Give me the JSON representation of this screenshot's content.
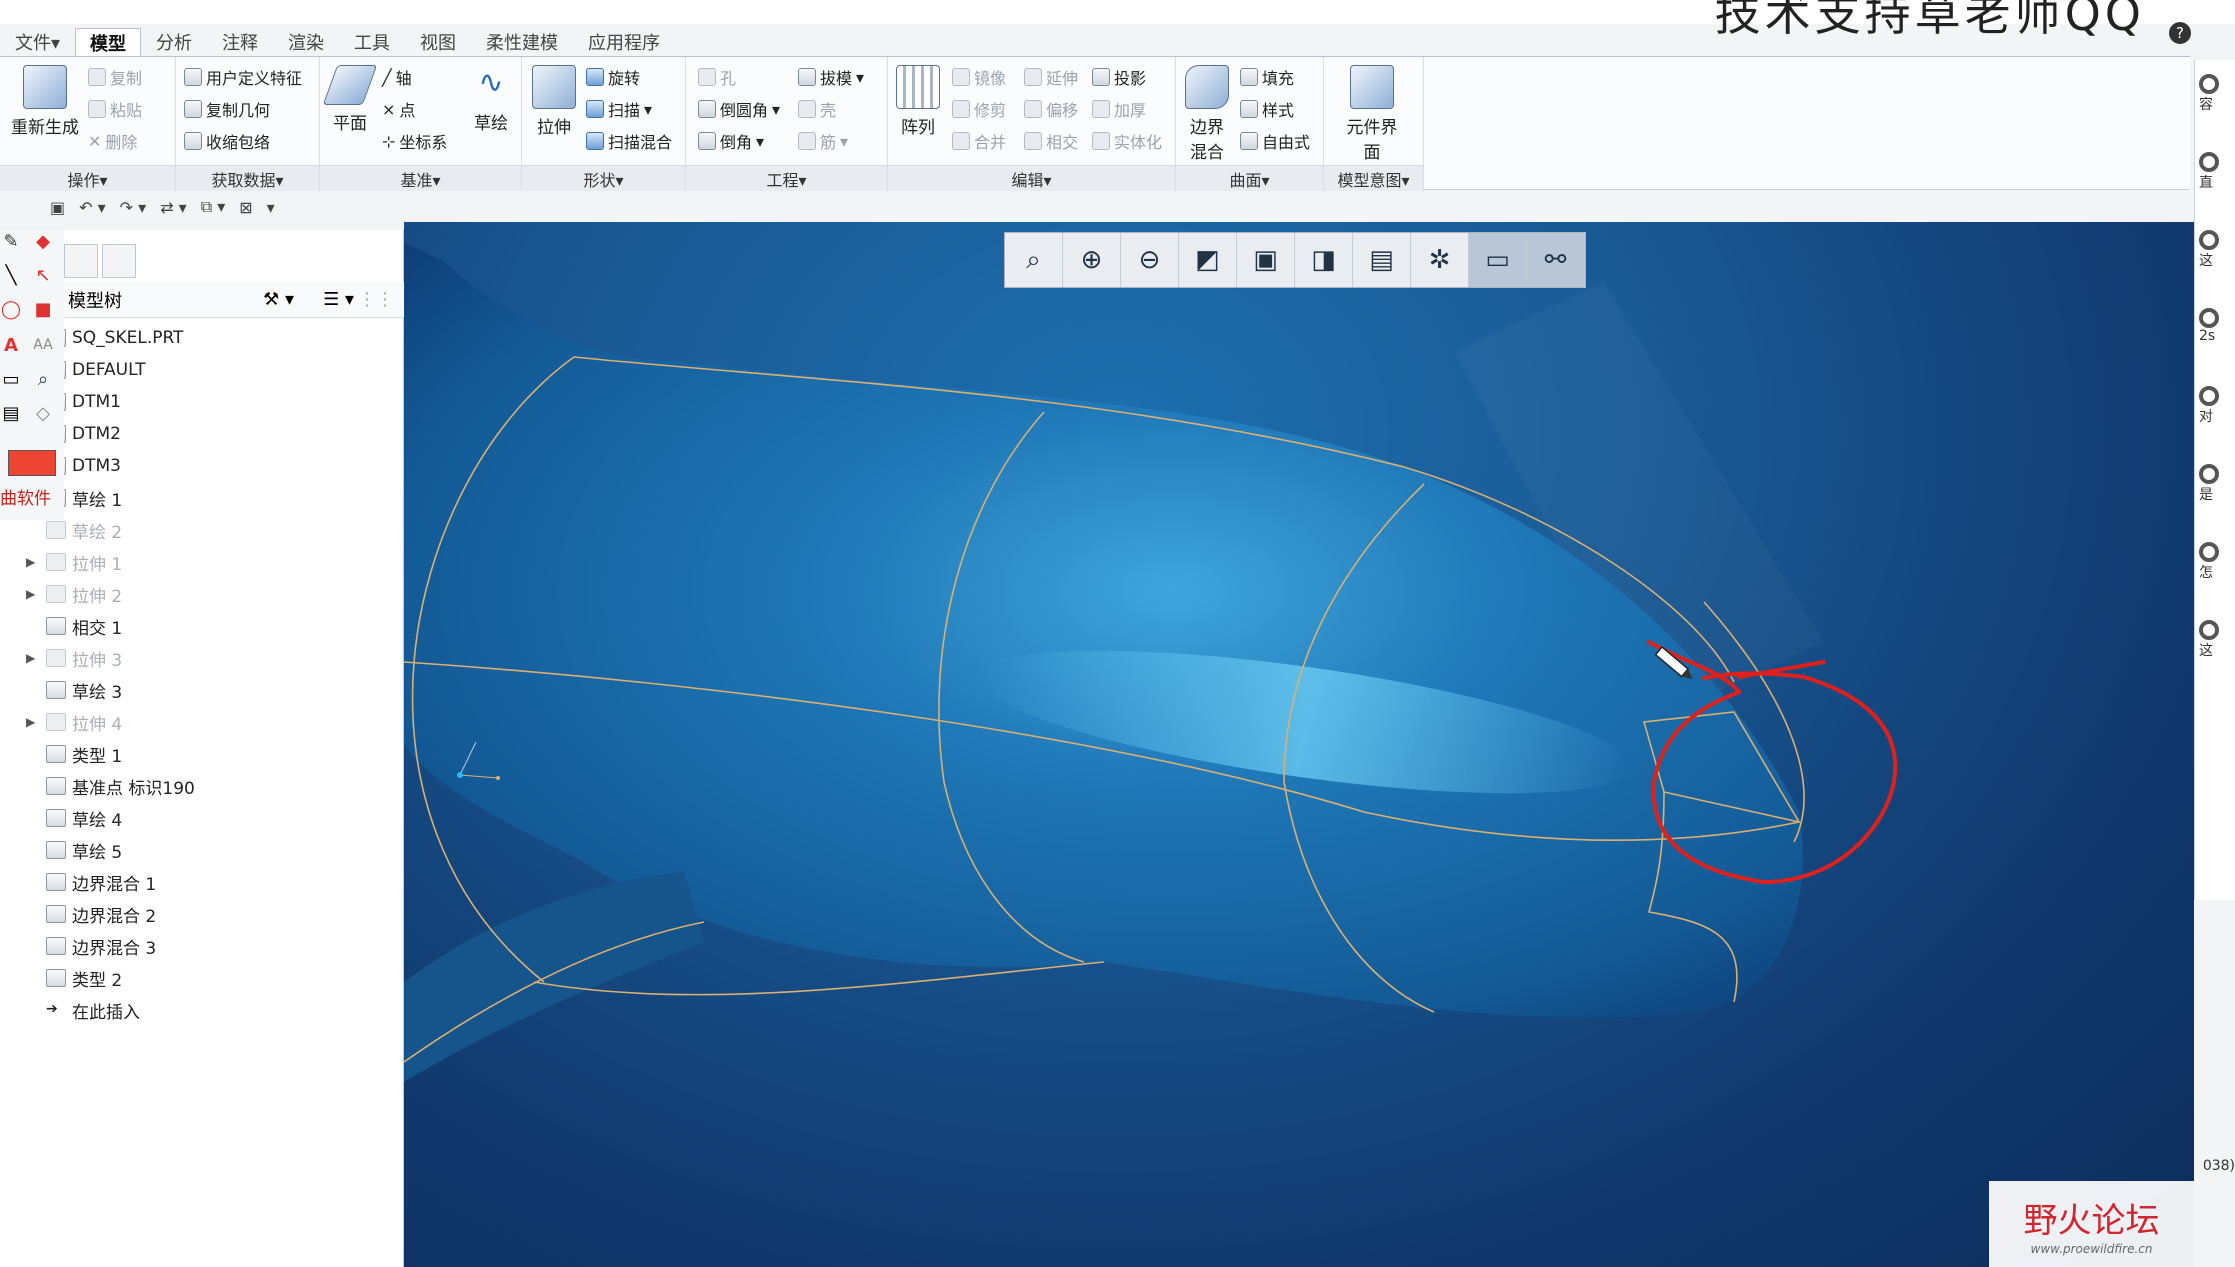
{
  "window": {
    "overlay_title": "技术支持草老师QQ"
  },
  "menu_tabs": [
    "文件▾",
    "模型",
    "分析",
    "注释",
    "渲染",
    "工具",
    "视图",
    "柔性建模",
    "应用程序"
  ],
  "ribbon": {
    "operations": {
      "label": "操作▾",
      "regenerate": "重新生成",
      "copy": "复制",
      "paste": "粘贴",
      "delete": "删除"
    },
    "get_data": {
      "label": "获取数据▾",
      "udf": "用户定义特征",
      "copy_geom": "复制几何",
      "shrinkwrap": "收缩包络"
    },
    "datum": {
      "label": "基准▾",
      "plane": "平面",
      "axis": "轴",
      "point": "点",
      "csys": "坐标系",
      "sketch": "草绘"
    },
    "shapes": {
      "label": "形状▾",
      "extrude": "拉伸",
      "revolve": "旋转",
      "sweep": "扫描",
      "swept_blend": "扫描混合"
    },
    "engineering": {
      "label": "工程▾",
      "hole": "孔",
      "round": "倒圆角",
      "chamfer": "倒角",
      "draft": "拔模",
      "shell": "壳",
      "rib": "筋"
    },
    "editing": {
      "label": "编辑▾",
      "pattern": "阵列",
      "mirror": "镜像",
      "extend": "延伸",
      "project": "投影",
      "trim": "修剪",
      "offset": "偏移",
      "thicken": "加厚",
      "merge": "合并",
      "intersect": "相交",
      "solidify": "实体化"
    },
    "surfaces": {
      "label": "曲面▾",
      "boundary_blend": "边界混合",
      "fill": "填充",
      "style": "样式",
      "freestyle": "自由式"
    },
    "model_intent": {
      "label": "模型意图▾",
      "component_interface": "元件界面"
    }
  },
  "left_panel": {
    "tree_header": "模型树",
    "red_label": "曲软件",
    "items": [
      {
        "label": "SQ_SKEL.PRT",
        "state": "normal"
      },
      {
        "label": "DEFAULT",
        "state": "normal"
      },
      {
        "label": "DTM1",
        "state": "normal"
      },
      {
        "label": "DTM2",
        "state": "normal"
      },
      {
        "label": "DTM3",
        "state": "normal"
      },
      {
        "label": "草绘 1",
        "state": "normal"
      },
      {
        "label": "草绘 2",
        "state": "disabled"
      },
      {
        "label": "拉伸 1",
        "state": "disabled",
        "expandable": true
      },
      {
        "label": "拉伸 2",
        "state": "disabled",
        "expandable": true
      },
      {
        "label": "相交 1",
        "state": "normal"
      },
      {
        "label": "拉伸 3",
        "state": "disabled",
        "expandable": true
      },
      {
        "label": "草绘 3",
        "state": "normal"
      },
      {
        "label": "拉伸 4",
        "state": "disabled",
        "expandable": true
      },
      {
        "label": "类型 1",
        "state": "normal"
      },
      {
        "label": "基准点 标识190",
        "state": "normal"
      },
      {
        "label": "草绘 4",
        "state": "normal"
      },
      {
        "label": "草绘 5",
        "state": "normal"
      },
      {
        "label": "边界混合 1",
        "state": "normal"
      },
      {
        "label": "边界混合 2",
        "state": "normal"
      },
      {
        "label": "边界混合 3",
        "state": "normal"
      },
      {
        "label": "类型 2",
        "state": "normal"
      },
      {
        "label": "在此插入",
        "state": "insert"
      }
    ]
  },
  "right_strip": [
    "容",
    "直",
    "这",
    "2s",
    "对",
    "是",
    "怎",
    "这"
  ],
  "status_fragment": "038)",
  "watermark": {
    "main": "野火论坛",
    "sub": "www.proewildfire.cn"
  },
  "colors": {
    "surface": "#1f6ea8",
    "edge": "#d9b072",
    "annotation": "#e0201a",
    "background": "#0f3a6e"
  }
}
